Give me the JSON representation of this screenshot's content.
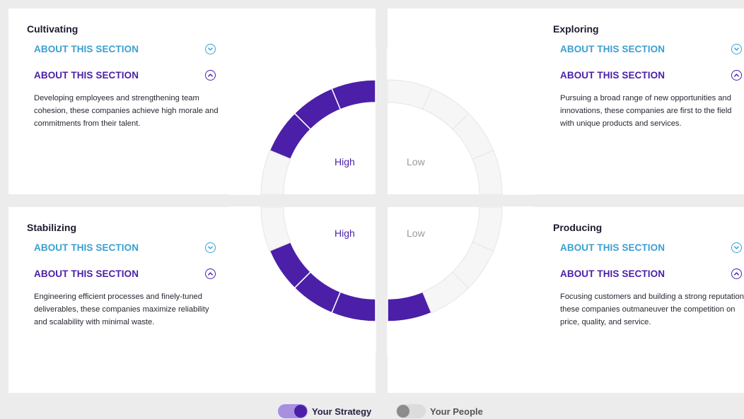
{
  "quadrants": {
    "cultivating": {
      "title": "Cultivating",
      "collapsed_label": "ABOUT THIS SECTION",
      "expanded_label": "ABOUT THIS SECTION",
      "description": "Developing employees and strengthening team cohesion, these companies achieve high morale and commitments from their talent."
    },
    "exploring": {
      "title": "Exploring",
      "collapsed_label": "ABOUT THIS SECTION",
      "expanded_label": "ABOUT THIS SECTION",
      "description": "Pursuing a broad range of new opportunities and innovations, these companies are first to the field with unique products and services."
    },
    "stabilizing": {
      "title": "Stabilizing",
      "collapsed_label": "ABOUT THIS SECTION",
      "expanded_label": "ABOUT THIS SECTION",
      "description": "Engineering efficient processes and finely-tuned deliverables, these companies maximize reliability and scalability with minimal waste."
    },
    "producing": {
      "title": "Producing",
      "collapsed_label": "ABOUT THIS SECTION",
      "expanded_label": "ABOUT THIS SECTION",
      "description": "Focusing customers and building a strong reputation, these companies outmaneuver the competition on price, quality, and service."
    }
  },
  "levels": {
    "top_left": "High",
    "top_right": "Low",
    "bottom_left": "High",
    "bottom_right": "Low"
  },
  "wheel": {
    "segments_per_quadrant": 4,
    "strategy_segments": {
      "cultivating": 3,
      "exploring": 0,
      "stabilizing": 3,
      "producing": 1
    },
    "colors": {
      "track": "#eeeeee",
      "fill": "#4b1fa8"
    }
  },
  "legend": {
    "strategy": {
      "label": "Your Strategy",
      "enabled": true
    },
    "people": {
      "label": "Your People",
      "enabled": false
    }
  },
  "colors": {
    "accent": "#4b1fa8",
    "link": "#3aa0d0",
    "background": "#ececec"
  }
}
